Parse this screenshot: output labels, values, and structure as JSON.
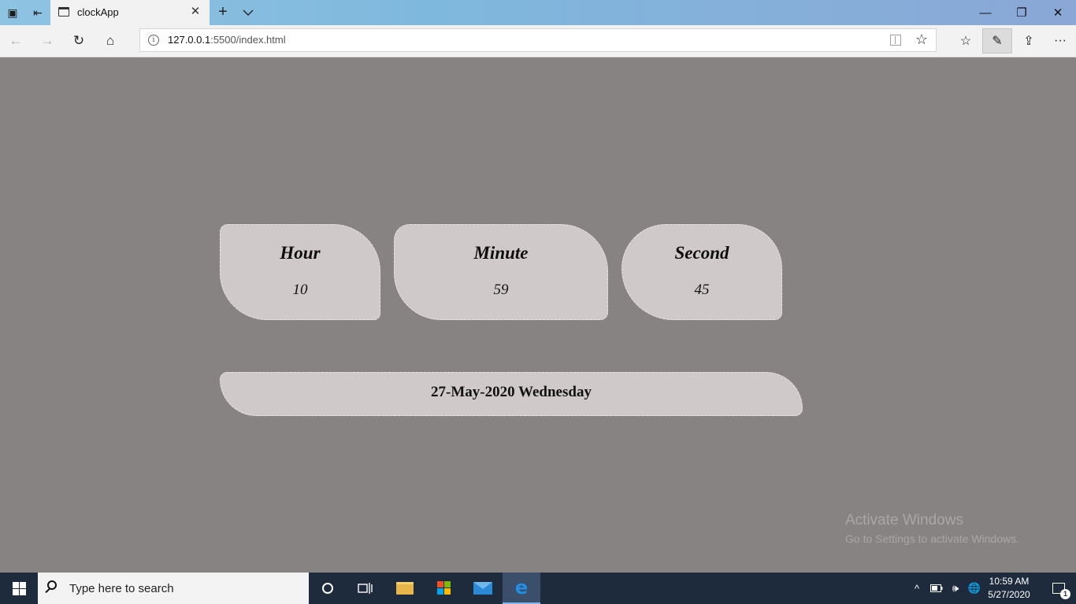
{
  "browser": {
    "tab": {
      "title": "clockApp",
      "close_glyph": "✕"
    },
    "new_tab_glyph": "+",
    "window_controls": {
      "minimize": "—",
      "restore": "❐",
      "close": "✕"
    },
    "nav": {
      "back_glyph": "←",
      "forward_glyph": "→",
      "refresh_glyph": "↻",
      "home_glyph": "⌂"
    },
    "address": {
      "host": "127.0.0.1",
      "rest": ":5500/index.html",
      "info_glyph": "i",
      "favorite_glyph": "☆"
    },
    "toolbar": {
      "favorites_glyph": "☆",
      "notes_glyph": "✎",
      "share_glyph": "⇪",
      "more_glyph": "···"
    }
  },
  "clock": {
    "hour": {
      "label": "Hour",
      "value": "10"
    },
    "minute": {
      "label": "Minute",
      "value": "59"
    },
    "second": {
      "label": "Second",
      "value": "45"
    },
    "date": "27-May-2020 Wednesday"
  },
  "watermark": {
    "title": "Activate Windows",
    "subtitle": "Go to Settings to activate Windows."
  },
  "taskbar": {
    "search_placeholder": "Type here to search",
    "time": "10:59 AM",
    "date": "5/27/2020",
    "notification_count": "1",
    "tray": {
      "chevron": "^",
      "volume": "🕪",
      "network": "🌐"
    }
  },
  "colors": {
    "page_background": "#878382",
    "card_background": "#cfc9c9",
    "taskbar": "#1e2b3c",
    "edge_blue": "#1f8fe6"
  }
}
